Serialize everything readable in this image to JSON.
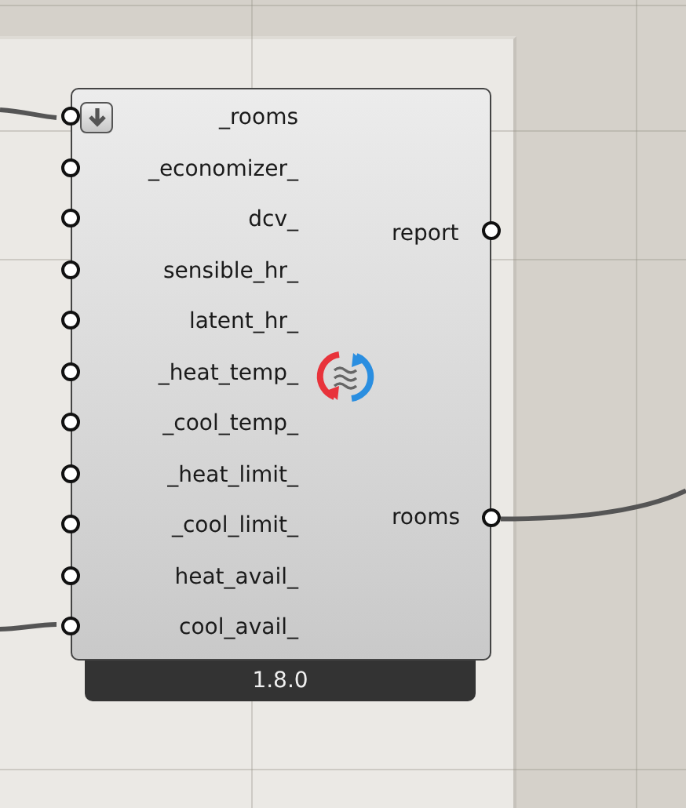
{
  "component": {
    "inputs": [
      {
        "label": "_rooms",
        "wired": true,
        "flatten": true
      },
      {
        "label": "_economizer_",
        "wired": false,
        "flatten": false
      },
      {
        "label": "dcv_",
        "wired": false,
        "flatten": false
      },
      {
        "label": "sensible_hr_",
        "wired": false,
        "flatten": false
      },
      {
        "label": "latent_hr_",
        "wired": false,
        "flatten": false
      },
      {
        "label": "_heat_temp_",
        "wired": false,
        "flatten": false
      },
      {
        "label": "_cool_temp_",
        "wired": false,
        "flatten": false
      },
      {
        "label": "_heat_limit_",
        "wired": false,
        "flatten": false
      },
      {
        "label": "_cool_limit_",
        "wired": false,
        "flatten": false
      },
      {
        "label": "heat_avail_",
        "wired": false,
        "flatten": false
      },
      {
        "label": "cool_avail_",
        "wired": true,
        "flatten": false
      }
    ],
    "outputs": [
      {
        "label": "report",
        "wired": false
      },
      {
        "label": "rooms",
        "wired": true
      }
    ],
    "version": "1.8.0"
  }
}
